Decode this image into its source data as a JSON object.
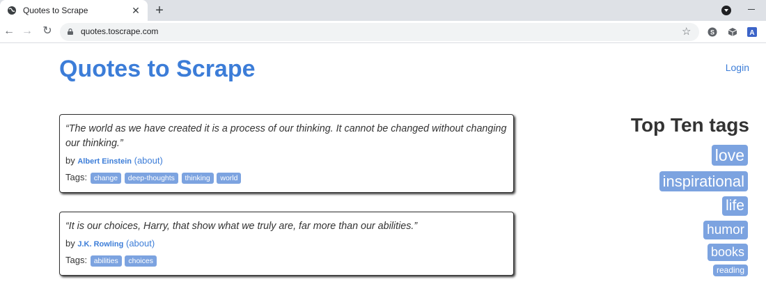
{
  "browser": {
    "tab_title": "Quotes to Scrape",
    "url": "quotes.toscrape.com"
  },
  "page": {
    "site_title": "Quotes to Scrape",
    "login_label": "Login"
  },
  "quotes": [
    {
      "text": "“The world as we have created it is a process of our thinking. It cannot be changed without changing our thinking.”",
      "by_label": "by",
      "author": "Albert Einstein",
      "about_label": "(about)",
      "tags_label": "Tags:",
      "tags": [
        "change",
        "deep-thoughts",
        "thinking",
        "world"
      ]
    },
    {
      "text": "“It is our choices, Harry, that show what we truly are, far more than our abilities.”",
      "by_label": "by",
      "author": "J.K. Rowling",
      "about_label": "(about)",
      "tags_label": "Tags:",
      "tags": [
        "abilities",
        "choices"
      ]
    }
  ],
  "top_tags": {
    "title": "Top Ten tags",
    "items": [
      "love",
      "inspirational",
      "life",
      "humor",
      "books",
      "reading"
    ]
  },
  "colors": {
    "link": "#3c7dd8",
    "tag_bg": "#7ca3e0",
    "text": "#333333"
  }
}
